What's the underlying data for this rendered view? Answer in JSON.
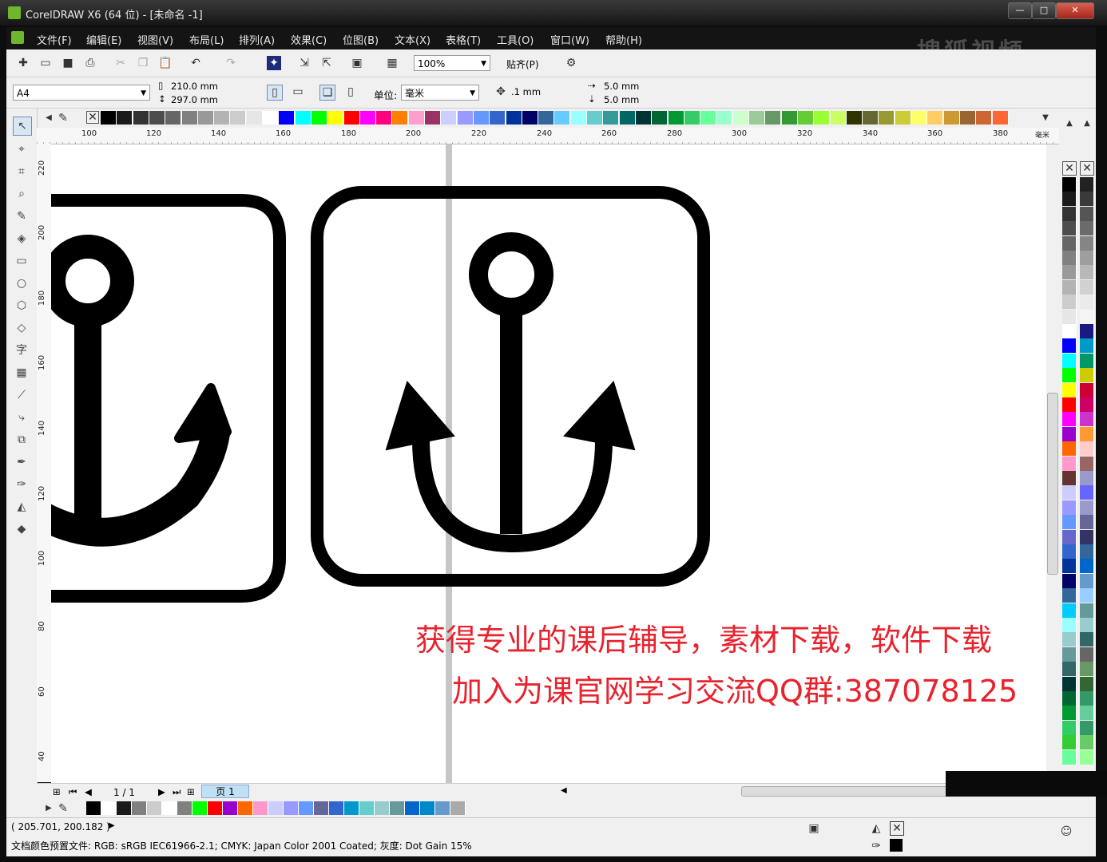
{
  "window": {
    "title": "CorelDRAW X6 (64 位) - [未命名 -1]",
    "min": "—",
    "max": "□",
    "close": "✕"
  },
  "menu": [
    "文件(F)",
    "编辑(E)",
    "视图(V)",
    "布局(L)",
    "排列(A)",
    "效果(C)",
    "位图(B)",
    "文本(X)",
    "表格(T)",
    "工具(O)",
    "窗口(W)",
    "帮助(H)"
  ],
  "watermark": "搜狐视频",
  "standard_toolbar": {
    "zoom": "100%",
    "snap": "贴齐(P)"
  },
  "property_bar": {
    "page_size": "A4",
    "width": "210.0 mm",
    "height": "297.0 mm",
    "unit_label": "单位:",
    "unit": "毫米",
    "nudge": ".1 mm",
    "dup_x": "5.0 mm",
    "dup_y": "5.0 mm"
  },
  "ruler": {
    "h_ticks": [
      "100",
      "120",
      "140",
      "160",
      "180",
      "200",
      "220",
      "240",
      "260",
      "280",
      "300",
      "320",
      "340",
      "360",
      "380"
    ],
    "h_unit": "毫米",
    "v_ticks": [
      "220",
      "200",
      "180",
      "160",
      "140",
      "120",
      "100",
      "80",
      "60",
      "40"
    ]
  },
  "canvas": {
    "promo_line1": "获得专业的课后辅导，素材下载，软件下载",
    "promo_line2": "加入为课官网学习交流QQ群:387078125"
  },
  "pagebar": {
    "page_count": "1 / 1",
    "page_tab": "页 1"
  },
  "status": {
    "coords": "( 205.701, 200.182 )",
    "color_profile": "文档颜色预置文件: RGB: sRGB IEC61966-2.1; CMYK: Japan Color 2001 Coated; 灰度: Dot Gain 15%"
  },
  "colors": {
    "top_palette": [
      "#000000",
      "#1a1a1a",
      "#333333",
      "#4d4d4d",
      "#666666",
      "#808080",
      "#999999",
      "#b3b3b3",
      "#cccccc",
      "#e6e6e6",
      "#ffffff",
      "#0000ff",
      "#00ffff",
      "#00ff00",
      "#ffff00",
      "#ff0000",
      "#ff00ff",
      "#ff0080",
      "#ff8000",
      "#ff9ecf",
      "#993366",
      "#cccfff",
      "#9999ff",
      "#6699ff",
      "#3366cc",
      "#003399",
      "#000066",
      "#336699",
      "#66ccff",
      "#99ffff",
      "#66cccc",
      "#339999",
      "#006666",
      "#003333",
      "#006633",
      "#009933",
      "#33cc66",
      "#66ff99",
      "#99ffcc",
      "#ccffcc",
      "#99cc99",
      "#669966",
      "#339933",
      "#66cc33",
      "#99ff33",
      "#ccff66",
      "#333300",
      "#666633",
      "#999933",
      "#cccc33",
      "#ffff66",
      "#ffcc66",
      "#cc9933",
      "#996633",
      "#cc6633",
      "#ff6633"
    ],
    "right_palette_a": [
      "#000000",
      "#1a1a1a",
      "#333333",
      "#4d4d4d",
      "#666666",
      "#808080",
      "#999999",
      "#b3b3b3",
      "#cccccc",
      "#e6e6e6",
      "#ffffff",
      "#0000ff",
      "#00ffff",
      "#00ff00",
      "#ffff00",
      "#ff0000",
      "#ff00ff",
      "#9900cc",
      "#ff6600",
      "#ff99cc",
      "#663333",
      "#ccccff",
      "#9999ff",
      "#6699ff",
      "#6666cc",
      "#3366cc",
      "#003399",
      "#000066",
      "#336699",
      "#00ccff",
      "#99ffff",
      "#99cccc",
      "#669999",
      "#336666",
      "#003333",
      "#006633",
      "#009933",
      "#33cc66",
      "#33cc33",
      "#66ff99"
    ],
    "right_palette_b": [
      "#222222",
      "#3a3a3a",
      "#555555",
      "#6b6b6b",
      "#858585",
      "#9e9e9e",
      "#b8b8b8",
      "#d1d1d1",
      "#ebebeb",
      "#f5f5f5",
      "#1a1a80",
      "#0099cc",
      "#009966",
      "#cccc00",
      "#cc0033",
      "#cc0066",
      "#cc33cc",
      "#ff9933",
      "#ffcccc",
      "#996666",
      "#9999cc",
      "#6666ff",
      "#9999cc",
      "#666699",
      "#333366",
      "#336699",
      "#0066cc",
      "#6699cc",
      "#99ccff",
      "#669999",
      "#99cccc",
      "#336666",
      "#666666",
      "#669966",
      "#336633",
      "#339966",
      "#66cc99",
      "#339966",
      "#66cc66",
      "#99ff99"
    ],
    "doc_palette": [
      "#000000",
      "#ffffff",
      "#1a1a1a",
      "#808080",
      "#cccccc",
      "#ffffff",
      "#808080",
      "#00ff00",
      "#ff0000",
      "#9900cc",
      "#ff6600",
      "#ff99cc",
      "#ccccff",
      "#9999ff",
      "#6699ff",
      "#666699",
      "#3366cc",
      "#0099cc",
      "#66cccc",
      "#99cccc",
      "#669999",
      "#0066cc",
      "#0088cc",
      "#6699cc",
      "#aaaaaa"
    ]
  }
}
